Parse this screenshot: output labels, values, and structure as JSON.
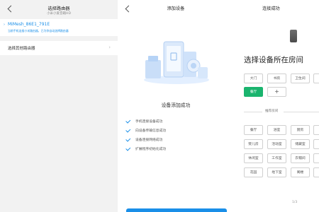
{
  "panel1": {
    "title": "选择路由器",
    "subtitle": "小米小爱音箱HD",
    "mesh_name": "MiMesh_86E1_791E",
    "mesh_hint": "当前手机连接小米路由器，已为你自动选择路由器",
    "other_label": "选择其他路由器"
  },
  "panel2": {
    "title": "添加设备",
    "success_text": "设备添加成功",
    "steps": [
      "手机连接设备成功",
      "向设备传输信息成功",
      "设备连接网络成功",
      "扩展程序初始化成功"
    ],
    "accent": "#1a8fe8"
  },
  "panel3": {
    "title": "连接成功",
    "question": "选择设备所在房间",
    "rooms": [
      "大门",
      "书房",
      "卫生间",
      "餐厅"
    ],
    "recommend_label": "推荐房间",
    "recommended": [
      "餐厅",
      "浴室",
      "厨房",
      "婴儿房",
      "活动室",
      "储藏室",
      "休闲室",
      "工作室",
      "衣帽间",
      "花园",
      "地下室",
      "阁楼"
    ],
    "pager": "1/3",
    "selected_color": "#1ab46e"
  }
}
